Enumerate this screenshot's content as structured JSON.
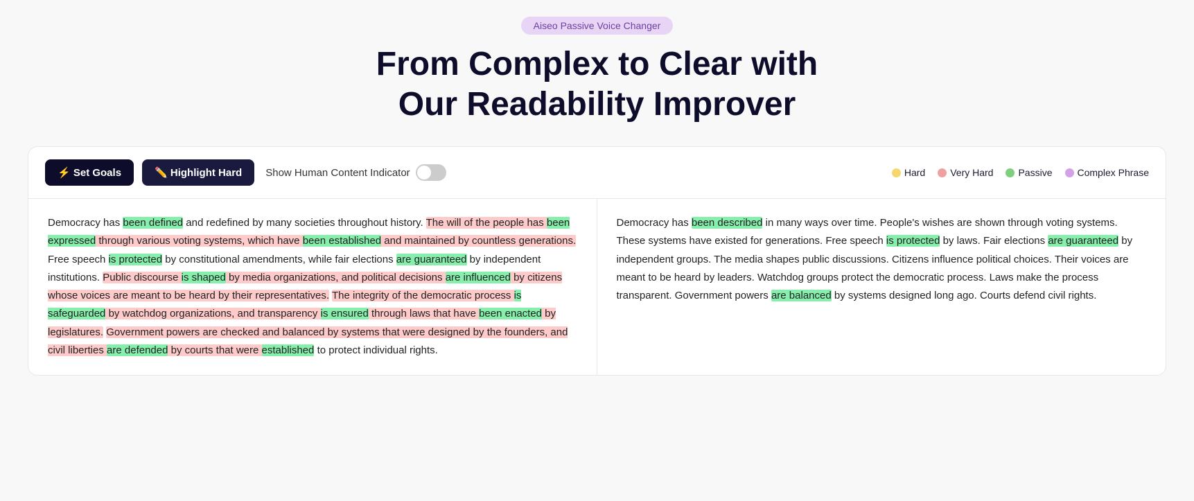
{
  "badge": "Aiseo Passive Voice Changer",
  "title_line1": "From Complex to Clear with",
  "title_line2": "Our Readability Improver",
  "toolbar": {
    "set_goals_label": "⚡ Set Goals",
    "highlight_hard_label": "✏️ Highlight Hard",
    "show_human_label": "Show Human Content Indicator"
  },
  "legend": {
    "hard": "Hard",
    "very_hard": "Very Hard",
    "passive": "Passive",
    "complex": "Complex Phrase"
  },
  "left_pane_id": "original-text",
  "right_pane_id": "simplified-text",
  "colors": {
    "accent": "#6b3fa0",
    "badge_bg": "#e8d5f5",
    "btn_dark": "#0d0d2b"
  }
}
